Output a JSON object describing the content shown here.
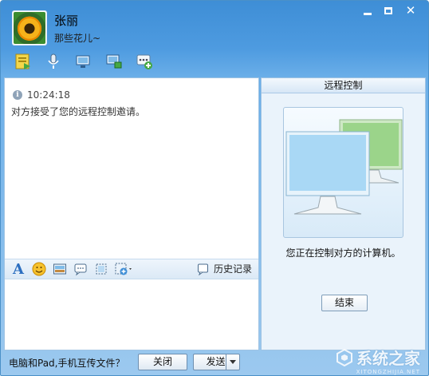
{
  "contact": {
    "name": "张丽",
    "signature": "那些花儿~"
  },
  "chat": {
    "messages": [
      {
        "time": "10:24:18",
        "text": "对方接受了您的远程控制邀请。"
      }
    ],
    "history_label": "历史记录"
  },
  "remote": {
    "title": "远程控制",
    "status": "您正在控制对方的计算机。",
    "end_label": "结束"
  },
  "bottom": {
    "file_tip": "电脑和Pad,手机互传文件？",
    "close_label": "关闭",
    "send_label": "发送"
  },
  "watermark": {
    "text": "系统之家",
    "sub": "XITONGZHIJIA.NET"
  },
  "icons": {
    "toolbar": [
      "file-transfer-icon",
      "voice-icon",
      "video-icon",
      "remote-desktop-icon",
      "more-apps-icon"
    ],
    "input_toolbar": [
      "font-icon",
      "emoji-icon",
      "image-icon",
      "shake-icon",
      "screenshot-icon",
      "more-icon",
      "history-icon"
    ]
  },
  "colors": {
    "title_blue": "#3e8ed6",
    "panel_bg": "#eaf3fb",
    "accent": "#2d6fc0"
  }
}
